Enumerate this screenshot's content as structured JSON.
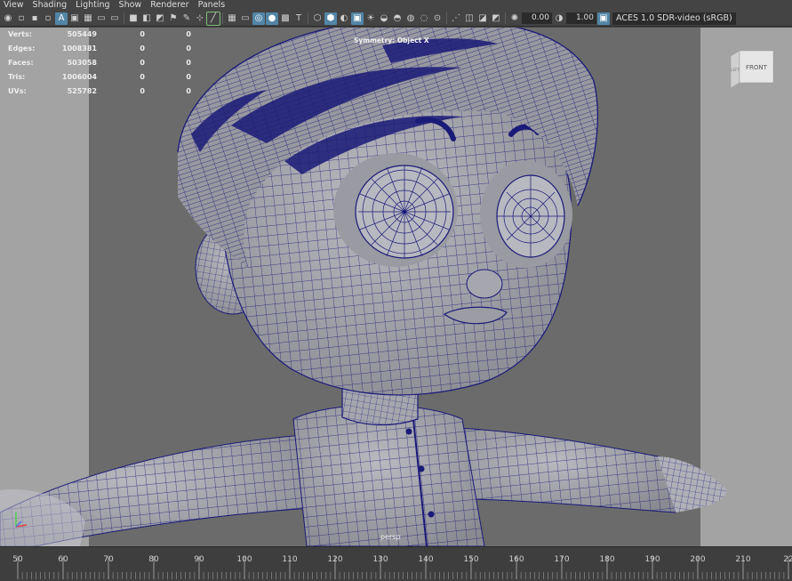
{
  "menu": [
    "View",
    "Shading",
    "Lighting",
    "Show",
    "Renderer",
    "Panels"
  ],
  "toolbar": {
    "exposure_value": "0.00",
    "gamma_value": "1.00",
    "color_space": "ACES 1.0 SDR-video (sRGB)"
  },
  "hud": {
    "rows": [
      {
        "label": "Verts:",
        "v1": "505449",
        "v2": "0",
        "v3": "0"
      },
      {
        "label": "Edges:",
        "v1": "1008381",
        "v2": "0",
        "v3": "0"
      },
      {
        "label": "Faces:",
        "v1": "503058",
        "v2": "0",
        "v3": "0"
      },
      {
        "label": "Tris:",
        "v1": "1006004",
        "v2": "0",
        "v3": "0"
      },
      {
        "label": "UVs:",
        "v1": "525782",
        "v2": "0",
        "v3": "0"
      }
    ]
  },
  "symmetry_label": "Symmetry: Object X",
  "camera_label": "persp",
  "viewcube": {
    "face_front": "FRONT",
    "face_side": "LEFT"
  },
  "timeline": {
    "ticks": [
      "50",
      "60",
      "70",
      "80",
      "90",
      "100",
      "110",
      "120",
      "130",
      "140",
      "150",
      "160",
      "170",
      "180",
      "190",
      "200",
      "210",
      "22"
    ]
  },
  "colors": {
    "wireframe": "#1a1a78",
    "viewport_bg": "#6b6b6b",
    "resolution_gate": "#a3a3a3",
    "toolbar_highlight": "#5285a6"
  }
}
